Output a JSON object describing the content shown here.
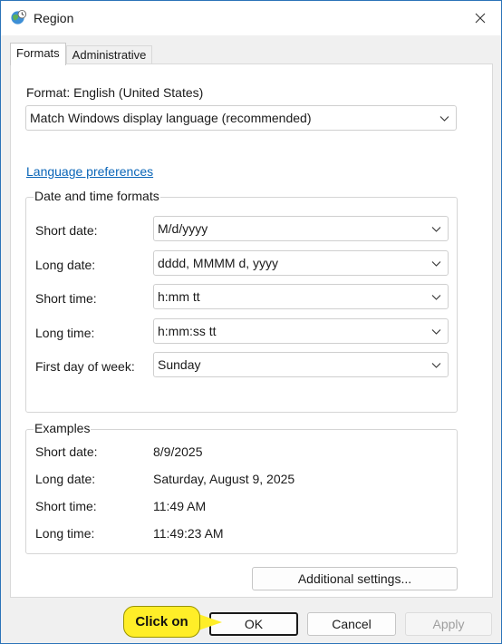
{
  "window": {
    "title": "Region",
    "accent_color": "#0b66b8"
  },
  "tabs": [
    {
      "label": "Formats",
      "active": true
    },
    {
      "label": "Administrative",
      "active": false
    }
  ],
  "format": {
    "label": "Format: English (United States)",
    "value": "Match Windows display language (recommended)"
  },
  "language_link": "Language preferences",
  "date_time": {
    "title": "Date and time formats",
    "fields": [
      {
        "label": "Short date:",
        "value": "M/d/yyyy"
      },
      {
        "label": "Long date:",
        "value": "dddd, MMMM d, yyyy"
      },
      {
        "label": "Short time:",
        "value": "h:mm tt"
      },
      {
        "label": "Long time:",
        "value": "h:mm:ss tt"
      },
      {
        "label": "First day of week:",
        "value": "Sunday"
      }
    ]
  },
  "examples": {
    "title": "Examples",
    "rows": [
      {
        "label": "Short date:",
        "value": "8/9/2025"
      },
      {
        "label": "Long date:",
        "value": "Saturday, August 9, 2025"
      },
      {
        "label": "Short time:",
        "value": "11:49 AM"
      },
      {
        "label": "Long time:",
        "value": "11:49:23 AM"
      }
    ]
  },
  "buttons": {
    "additional": "Additional settings...",
    "ok": "OK",
    "cancel": "Cancel",
    "apply": "Apply"
  },
  "callout": "Click on"
}
